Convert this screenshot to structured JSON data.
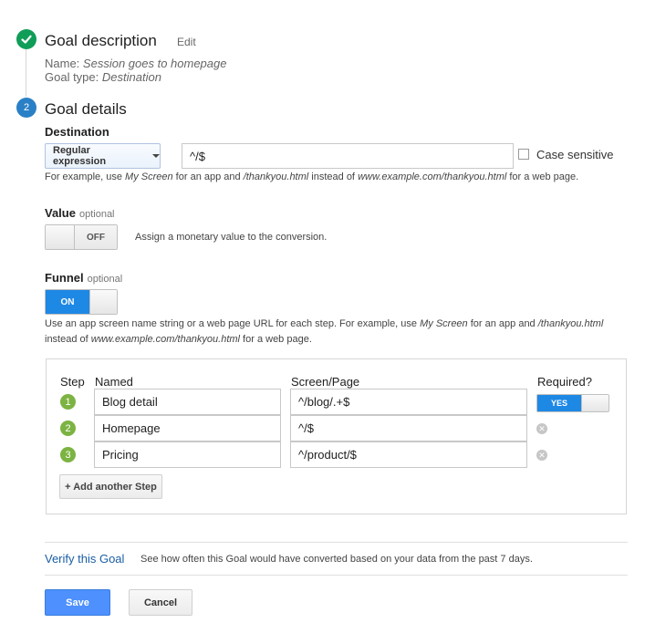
{
  "goal_description": {
    "title": "Goal description",
    "edit_label": "Edit",
    "name_label": "Name:",
    "name_value": "Session goes to homepage",
    "type_label": "Goal type:",
    "type_value": "Destination"
  },
  "goal_details": {
    "step_number": "2",
    "title": "Goal details",
    "destination": {
      "label": "Destination",
      "match_type": "Regular expression",
      "value": "^/$",
      "case_sensitive_label": "Case sensitive",
      "case_sensitive_checked": false,
      "hint_1": "For example, use ",
      "hint_app": "My Screen",
      "hint_2": " for an app and ",
      "hint_url": "/thankyou.html",
      "hint_3": " instead of ",
      "hint_site": "www.example.com/thankyou.html",
      "hint_4": " for a web page."
    },
    "value": {
      "label": "Value",
      "optional": "optional",
      "toggle_state": "OFF",
      "description": "Assign a monetary value to the conversion."
    },
    "funnel": {
      "label": "Funnel",
      "optional": "optional",
      "toggle_state": "ON",
      "hint_1": "Use an app screen name string or a web page URL for each step. For example, use ",
      "hint_app": "My Screen",
      "hint_2": " for an app and ",
      "hint_url": "/thankyou.html",
      "hint_3": "instead of ",
      "hint_site": "www.example.com/thankyou.html",
      "hint_4": " for a web page.",
      "columns": {
        "step": "Step",
        "named": "Named",
        "screen": "Screen/Page",
        "required": "Required?"
      },
      "steps": [
        {
          "num": "1",
          "name": "Blog detail",
          "screen": "^/blog/.+$",
          "required": "YES"
        },
        {
          "num": "2",
          "name": "Homepage",
          "screen": "^/$"
        },
        {
          "num": "3",
          "name": "Pricing",
          "screen": "^/product/$"
        }
      ],
      "add_step_label": "+ Add another Step"
    }
  },
  "verify": {
    "link_label": "Verify this Goal",
    "description": "See how often this Goal would have converted based on your data from the past 7 days."
  },
  "actions": {
    "save_label": "Save",
    "cancel_label": "Cancel"
  },
  "colors": {
    "success": "#0f9d58",
    "step_active": "#2a80c6",
    "toggle_on": "#1a73e8",
    "funnel_step": "#7cb342",
    "save_button": "#4d90fe",
    "link": "#15c"
  }
}
